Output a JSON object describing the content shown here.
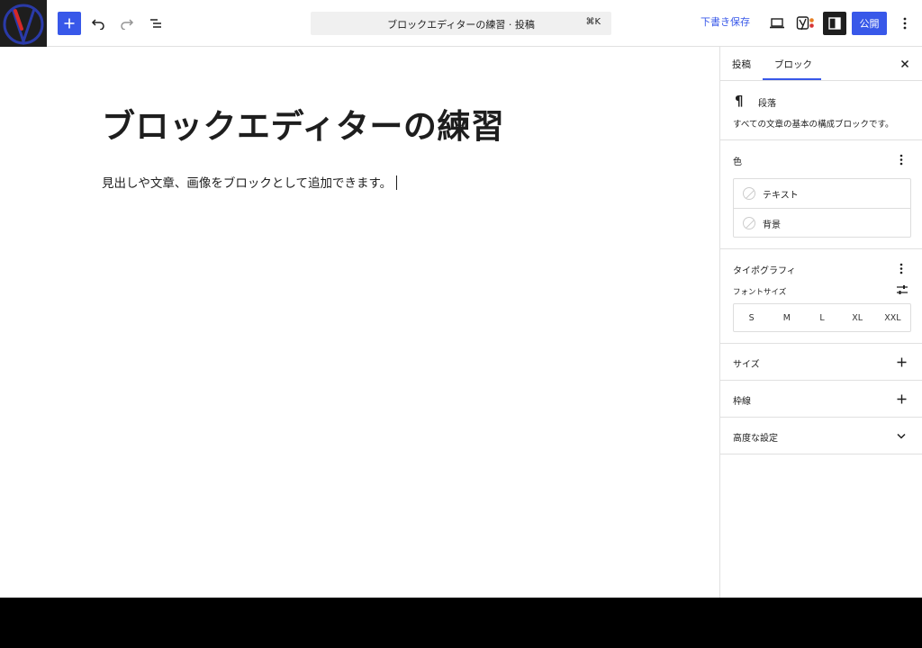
{
  "header": {
    "command_title": "ブロックエディターの練習 · 投稿",
    "command_shortcut": "⌘K",
    "save_draft_label": "下書き保存",
    "publish_label": "公開",
    "icons": [
      "site-logo",
      "add-block-icon",
      "undo-icon",
      "redo-icon",
      "list-view-icon",
      "preview-icon",
      "yoast-icon",
      "settings-panel-icon",
      "more-options-icon"
    ]
  },
  "editor": {
    "title": "ブロックエディターの練習",
    "paragraph": "見出しや文章、画像をブロックとして追加できます。"
  },
  "sidebar": {
    "tabs": [
      "投稿",
      "ブロック"
    ],
    "active_tab": "ブロック",
    "block": {
      "icon": "¶",
      "name": "段落",
      "description": "すべての文章の基本の構成ブロックです。"
    },
    "color": {
      "title": "色",
      "items": [
        "テキスト",
        "背景"
      ]
    },
    "typography": {
      "title": "タイポグラフィ",
      "font_size_label": "フォントサイズ",
      "sizes": [
        "S",
        "M",
        "L",
        "XL",
        "XXL"
      ]
    },
    "dimensions": {
      "title": "サイズ"
    },
    "border": {
      "title": "枠線"
    },
    "advanced": {
      "title": "高度な設定"
    }
  },
  "colors": {
    "accent": "#3858e9",
    "text": "#1e1e1e",
    "border": "#e0e0e0"
  }
}
